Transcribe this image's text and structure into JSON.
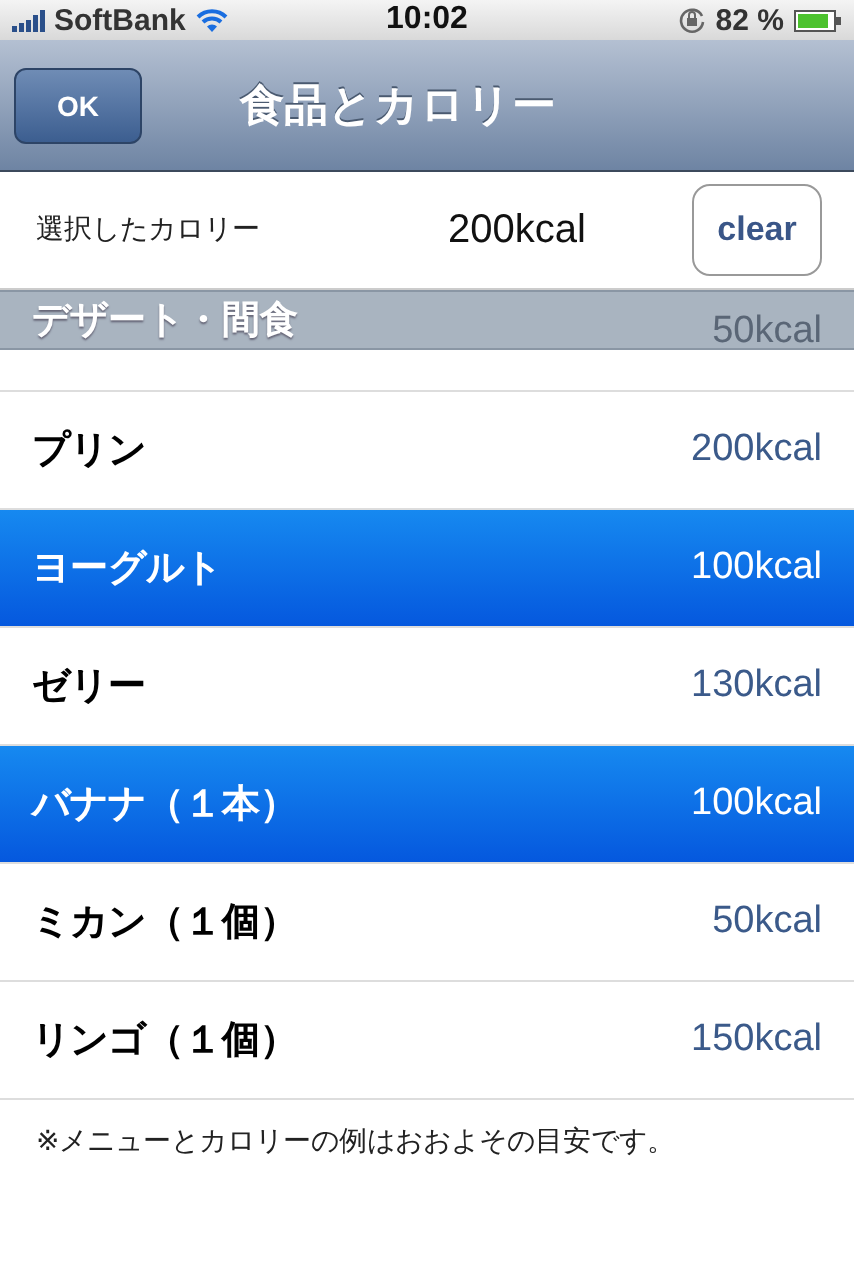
{
  "status_bar": {
    "carrier": "SoftBank",
    "time": "10:02",
    "battery": "82 %"
  },
  "nav_bar": {
    "title": "食品とカロリー",
    "left_button": "OK"
  },
  "selected_calories": {
    "label": "選択したカロリー",
    "value": "200kcal",
    "button": "clear"
  },
  "section": {
    "header": "デザート・間食",
    "partial_row_calories": "50kcal"
  },
  "rows": [
    {
      "name": "プリン",
      "calories": "200kcal",
      "selected": false
    },
    {
      "name": "ヨーグルト",
      "calories": "100kcal",
      "selected": true
    },
    {
      "name": "ゼリー",
      "calories": "130kcal",
      "selected": false
    },
    {
      "name": "バナナ（１本）",
      "calories": "100kcal",
      "selected": true
    },
    {
      "name": "ミカン（１個）",
      "calories": "50kcal",
      "selected": false
    },
    {
      "name": "リンゴ（１個）",
      "calories": "150kcal",
      "selected": false
    }
  ],
  "footnote": "※メニューとカロリーの例はおおよその目安です。"
}
